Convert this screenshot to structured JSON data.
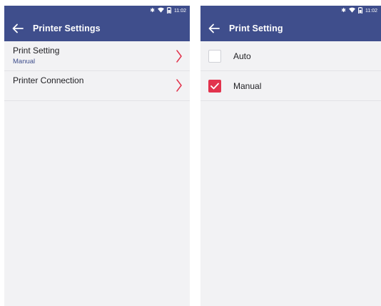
{
  "status_bar": {
    "time": "11:02",
    "icons": [
      "bluetooth-icon",
      "wifi-icon",
      "battery-icon"
    ]
  },
  "left_screen": {
    "title": "Printer Settings",
    "items": [
      {
        "label": "Print Setting",
        "value": "Manual"
      },
      {
        "label": "Printer Connection"
      }
    ]
  },
  "right_screen": {
    "title": "Print Setting",
    "options": [
      {
        "label": "Auto",
        "checked": false
      },
      {
        "label": "Manual",
        "checked": true
      }
    ]
  },
  "colors": {
    "app_bar": "#3f4e8c",
    "accent_red": "#e2334d",
    "background": "#f2f2f4"
  }
}
